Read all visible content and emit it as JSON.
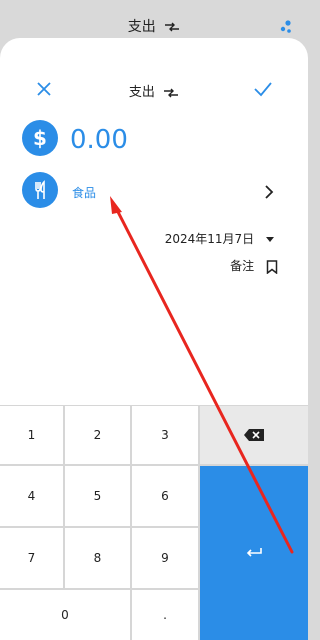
{
  "topbar": {
    "title": "支出",
    "swap_icon": "swap-arrows-icon",
    "menu_icon": "dots-cluster-icon"
  },
  "header": {
    "title": "支出",
    "close_icon": "close-icon",
    "confirm_icon": "check-icon",
    "swap_icon": "swap-arrows-icon"
  },
  "amount": {
    "value": "0.00",
    "icon": "dollar-icon"
  },
  "category": {
    "label": "食品",
    "icon": "cutlery-icon"
  },
  "date": {
    "value": "2024年11月7日"
  },
  "note": {
    "label": "备注",
    "icon": "bookmark-icon"
  },
  "keypad": {
    "k1": "1",
    "k2": "2",
    "k3": "3",
    "k4": "4",
    "k5": "5",
    "k6": "6",
    "k7": "7",
    "k8": "8",
    "k9": "9",
    "k0": "0",
    "kdot": ".",
    "backspace_icon": "backspace-icon",
    "enter_icon": "enter-icon"
  },
  "colors": {
    "accent": "#2b8de7",
    "annotation_arrow": "#e8261f"
  }
}
